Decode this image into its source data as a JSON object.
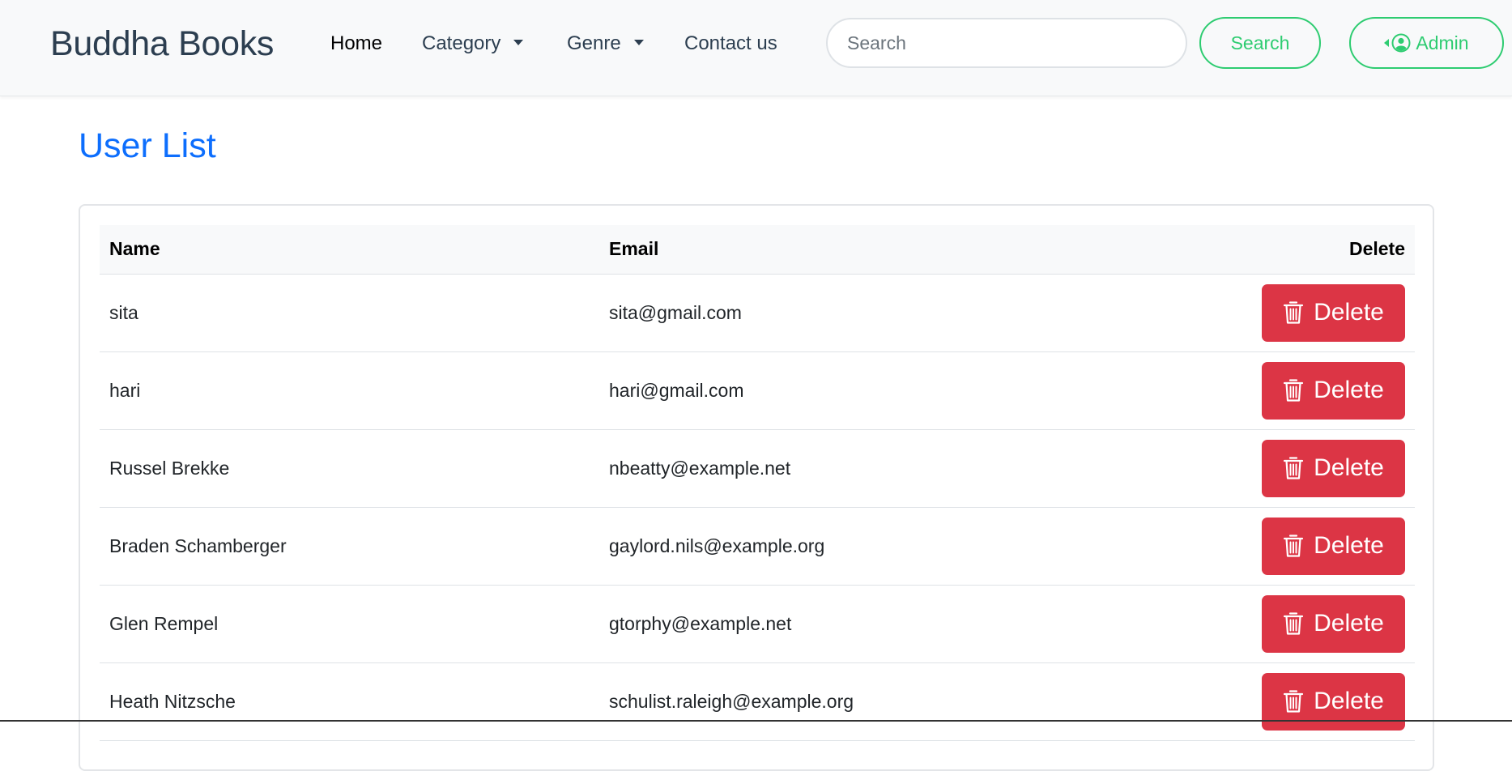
{
  "brand": "Buddha Books",
  "nav": {
    "home": "Home",
    "category": "Category",
    "genre": "Genre",
    "contact": "Contact us"
  },
  "search": {
    "placeholder": "Search",
    "button_label": "Search"
  },
  "admin": {
    "label": "Admin",
    "icon": "user-circle-icon"
  },
  "page_title": "User List",
  "colors": {
    "accent_green": "#2ecc71",
    "title_blue": "#0d6efd",
    "delete_red": "#dc3545"
  },
  "table": {
    "headers": {
      "name": "Name",
      "email": "Email",
      "delete": "Delete"
    },
    "delete_label": "Delete",
    "rows": [
      {
        "name": "sita",
        "email": "sita@gmail.com"
      },
      {
        "name": "hari",
        "email": "hari@gmail.com"
      },
      {
        "name": "Russel Brekke",
        "email": "nbeatty@example.net"
      },
      {
        "name": "Braden Schamberger",
        "email": "gaylord.nils@example.org"
      },
      {
        "name": "Glen Rempel",
        "email": "gtorphy@example.net"
      },
      {
        "name": "Heath Nitzsche",
        "email": "schulist.raleigh@example.org"
      }
    ]
  }
}
